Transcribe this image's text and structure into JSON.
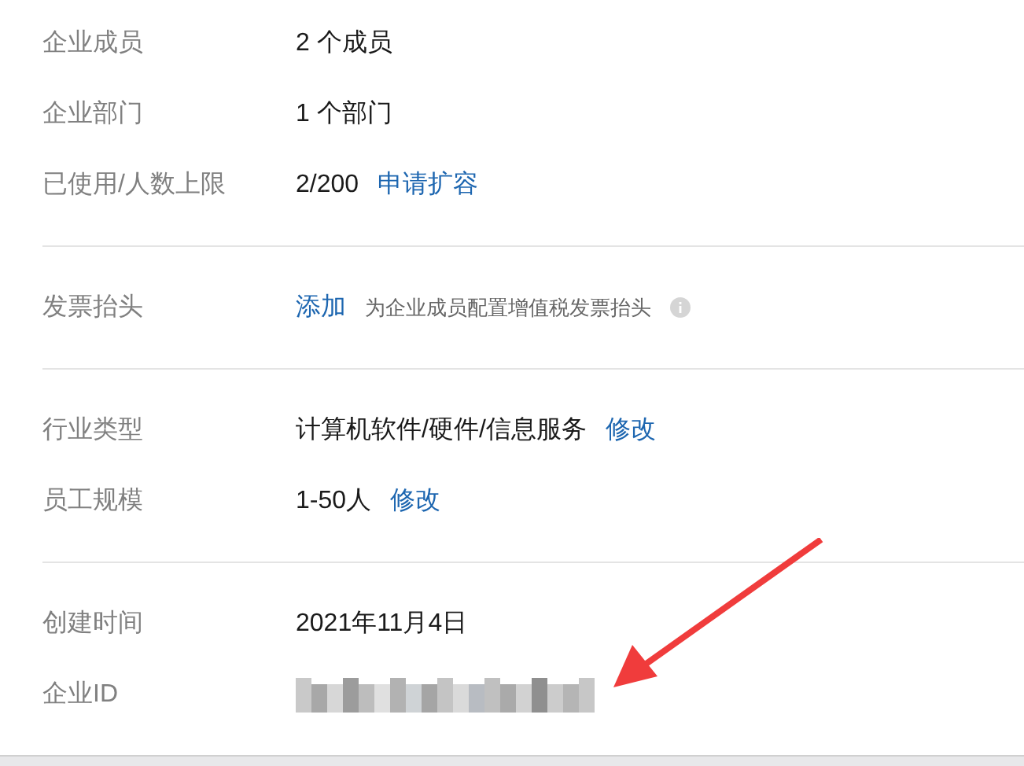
{
  "sections": [
    {
      "rows": [
        {
          "label": "企业成员",
          "items": [
            {
              "kind": "text",
              "text": "2 个成员"
            }
          ]
        },
        {
          "label": "企业部门",
          "items": [
            {
              "kind": "text",
              "text": "1 个部门"
            }
          ]
        },
        {
          "label": "已使用/人数上限",
          "items": [
            {
              "kind": "text",
              "text": "2/200"
            },
            {
              "kind": "link",
              "text": "申请扩容"
            }
          ]
        }
      ]
    },
    {
      "rows": [
        {
          "label": "发票抬头",
          "items": [
            {
              "kind": "link",
              "text": "添加"
            },
            {
              "kind": "hint",
              "text": "为企业成员配置增值税发票抬头"
            },
            {
              "kind": "info"
            }
          ]
        }
      ]
    },
    {
      "rows": [
        {
          "label": "行业类型",
          "items": [
            {
              "kind": "text",
              "text": "计算机软件/硬件/信息服务"
            },
            {
              "kind": "link",
              "text": "修改"
            }
          ]
        },
        {
          "label": "员工规模",
          "items": [
            {
              "kind": "text",
              "text": "1-50人"
            },
            {
              "kind": "link",
              "text": "修改"
            }
          ]
        }
      ]
    },
    {
      "rows": [
        {
          "label": "创建时间",
          "items": [
            {
              "kind": "text",
              "text": "2021年11月4日"
            }
          ]
        },
        {
          "label": "企业ID",
          "items": [
            {
              "kind": "redacted"
            }
          ]
        }
      ]
    }
  ]
}
